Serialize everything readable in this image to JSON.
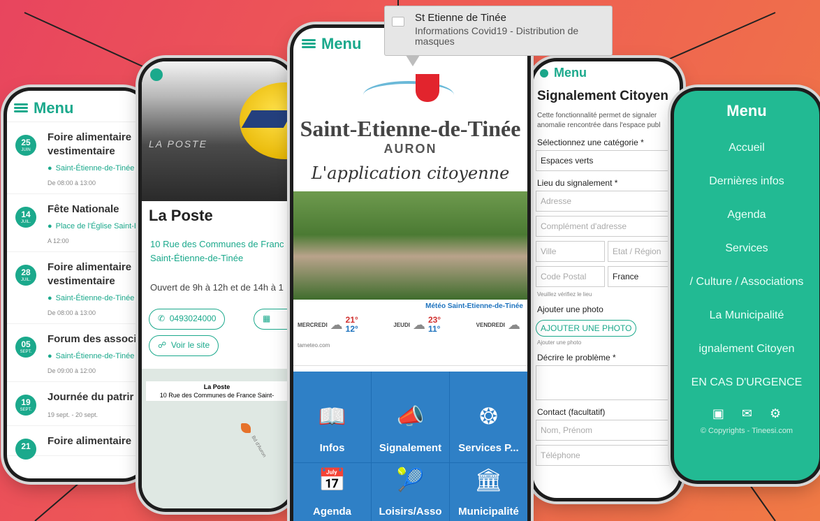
{
  "corner_text": "",
  "notification": {
    "title": "St Etienne de Tinée",
    "body": "Informations Covid19 - Distribution de masques"
  },
  "agenda": {
    "menu": "Menu",
    "events": [
      {
        "day": "25",
        "month": "JUIN",
        "title": "Foire alimentaire",
        "title2": "vestimentaire",
        "location": "Saint-Étienne-de-Tinée",
        "time": "De 08:00 à 13:00"
      },
      {
        "day": "14",
        "month": "JUIL.",
        "title": "Fête Nationale",
        "title2": "",
        "location": "Place de l'Église Saint-É",
        "time": "A 12:00"
      },
      {
        "day": "28",
        "month": "JUIL.",
        "title": "Foire alimentaire",
        "title2": "vestimentaire",
        "location": "Saint-Étienne-de-Tinée",
        "time": "De 08:00 à 13:00"
      },
      {
        "day": "05",
        "month": "SEPT.",
        "title": "Forum des associ",
        "title2": "",
        "location": "Saint-Étienne-de-Tinée",
        "time": "De 09:00 à 12:00"
      },
      {
        "day": "19",
        "month": "SEPT.",
        "title": "Journée du patrir",
        "title2": "",
        "location": "",
        "time": "19 sept. - 20 sept."
      },
      {
        "day": "21",
        "month": "",
        "title": "Foire alimentaire",
        "title2": "",
        "location": "",
        "time": ""
      }
    ]
  },
  "poste": {
    "photo_sign": "LA POSTE",
    "title": "La Poste",
    "address1": "10 Rue des Communes de Franc",
    "address2": "Saint-Étienne-de-Tinée",
    "hours": "Ouvert de 9h à 12h et de 14h à 1",
    "phone_btn": "0493024000",
    "site_btn": "Voir le site",
    "map_label_title": "La Poste",
    "map_label_addr": "10 Rue des Communes de France Saint-",
    "map_road": "Bd d'Auron"
  },
  "home": {
    "menu": "Menu",
    "brand": "Saint-Etienne-de-Tinée",
    "auron": "AURON",
    "tagline": "L'application citoyenne",
    "meteo_title": "Météo Saint-Etienne-de-Tinée",
    "days": [
      {
        "name": "MERCREDI",
        "hi": "21°",
        "lo": "12°"
      },
      {
        "name": "JEUDI",
        "hi": "23°",
        "lo": "11°"
      },
      {
        "name": "VENDREDI",
        "hi": "",
        "lo": ""
      }
    ],
    "meteo_source": "tameteo.com",
    "tiles": [
      "Infos",
      "Signalement",
      "Services P...",
      "Agenda",
      "Loisirs/Asso",
      "Municipalité"
    ]
  },
  "signalement": {
    "menu": "Menu",
    "title": "Signalement Citoyen",
    "desc1": "Cette fonctionnalité permet de signaler",
    "desc2": "anomalie rencontrée dans l'espace publ",
    "cat_label": "Sélectionnez une catégorie *",
    "cat_value": "Espaces verts",
    "lieu_label": "Lieu du signalement *",
    "address_ph": "Adresse",
    "complement_ph": "Complément d'adresse",
    "city_ph": "Ville",
    "state_ph": "Etat / Région",
    "zip_ph": "Code Postal",
    "country_value": "France",
    "verify_note": "Veuillez vérifiez le lieu",
    "photo_label": "Ajouter une photo",
    "photo_btn": "AJOUTER UNE PHOTO",
    "photo_note": "Ajouter une photo",
    "problem_label": "Décrire le problème *",
    "contact_label": "Contact (facultatif)",
    "name_ph": "Nom, Prénom",
    "phone_ph": "Téléphone"
  },
  "sidemenu": {
    "title": "Menu",
    "items": [
      "Accueil",
      "Dernières infos",
      "Agenda",
      "Services",
      "/ Culture / Associations",
      "La Municipalité",
      "ignalement Citoyen",
      "EN CAS D'URGENCE"
    ],
    "copyright": "© Copyrights - Tineesi.com"
  }
}
